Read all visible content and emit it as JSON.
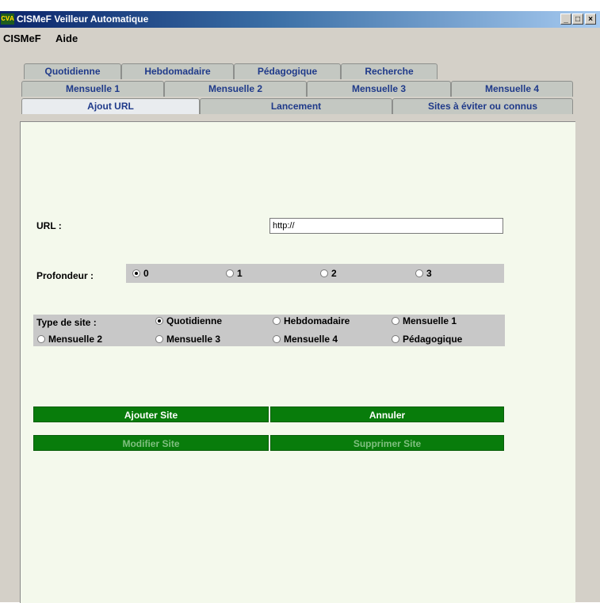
{
  "window": {
    "icon_text": "CVA",
    "title": "CISMeF Veilleur Automatique",
    "btn_min": "_",
    "btn_max": "□",
    "btn_close": "×"
  },
  "menu": [
    "CISMeF",
    "Aide"
  ],
  "tabs": {
    "row1": [
      "Quotidienne",
      "Hebdomadaire",
      "Pédagogique",
      "Recherche"
    ],
    "row2": [
      "Mensuelle 1",
      "Mensuelle 2",
      "Mensuelle 3",
      "Mensuelle 4"
    ],
    "row3": [
      "Ajout URL",
      "Lancement",
      "Sites à éviter ou connus"
    ],
    "active": "Ajout URL"
  },
  "form": {
    "url_label": "URL :",
    "url_value": "http://",
    "depth_label": "Profondeur :",
    "depth_options": [
      "0",
      "1",
      "2",
      "3"
    ],
    "depth_selected": "0",
    "type_label": "Type de site :",
    "type_options": [
      "Quotidienne",
      "Hebdomadaire",
      "Mensuelle 1",
      "Mensuelle 2",
      "Mensuelle 3",
      "Mensuelle 4",
      "Pédagogique"
    ],
    "type_selected": "Quotidienne"
  },
  "buttons": {
    "add": "Ajouter Site",
    "cancel": "Annuler",
    "modify": "Modifier Site",
    "delete": "Supprimer Site"
  },
  "colors": {
    "button_green": "#087c0b",
    "panel_bg": "#f4f9ec",
    "tab_text": "#1f3a8a"
  }
}
